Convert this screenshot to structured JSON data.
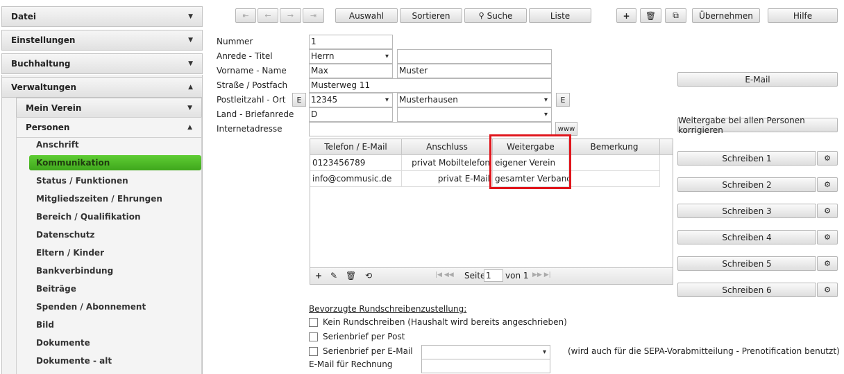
{
  "sidebar": {
    "sections": [
      "Datei",
      "Einstellungen",
      "Buchhaltung",
      "Verwaltungen"
    ],
    "sub_sections": [
      "Mein Verein",
      "Personen"
    ],
    "items": [
      "Anschrift",
      "Kommunikation",
      "Status / Funktionen",
      "Mitgliedszeiten / Ehrungen",
      "Bereich / Qualifikation",
      "Datenschutz",
      "Eltern / Kinder",
      "Bankverbindung",
      "Beiträge",
      "Spenden / Abonnement",
      "Bild",
      "Dokumente",
      "Dokumente - alt"
    ]
  },
  "toolbar": {
    "nav": [
      "⇤",
      "←",
      "→",
      "⇥"
    ],
    "auswahl": "Auswahl",
    "sortieren": "Sortieren",
    "suche": "Suche",
    "liste": "Liste",
    "add": "+",
    "delete": "🗑",
    "copy": "⧉",
    "uebernehmen": "Übernehmen",
    "hilfe": "Hilfe"
  },
  "form": {
    "labels": [
      "Nummer",
      "Anrede - Titel",
      "Vorname - Name",
      "Straße / Postfach",
      "Postleitzahl - Ort",
      "Land - Briefanrede",
      "Internetadresse"
    ],
    "nummer": "1",
    "anrede": "Herrn",
    "titel": "",
    "vorname": "Max",
    "name": "Muster",
    "strasse": "Musterweg 11",
    "plz": "12345",
    "ort": "Musterhausen",
    "land": "D",
    "briefanrede": "",
    "internet": "",
    "e_button": "E",
    "www_button": "www"
  },
  "grid": {
    "headers": [
      "Telefon / E-Mail",
      "Anschluss",
      "Weitergabe",
      "Bemerkung"
    ],
    "rows": [
      {
        "contact": "0123456789",
        "type": "privat Mobiltelefon",
        "share": "eigener Verein",
        "note": ""
      },
      {
        "contact": "info@commusic.de",
        "type": "privat E-Mail",
        "share": "gesamter Verband",
        "note": ""
      }
    ],
    "footer": {
      "page_label": "Seite",
      "page": "1",
      "of_label": "von 1"
    }
  },
  "right": {
    "email": "E-Mail",
    "weitergabe": "Weitergabe bei allen Personen korrigieren",
    "schreiben": [
      "Schreiben 1",
      "Schreiben 2",
      "Schreiben 3",
      "Schreiben 4",
      "Schreiben 5",
      "Schreiben 6"
    ]
  },
  "bottom": {
    "heading": "Bevorzugte Rundschreibenzustellung:",
    "options": [
      "Kein Rundschreiben (Haushalt wird bereits angeschrieben)",
      "Serienbrief per Post",
      "Serienbrief per E-Mail"
    ],
    "sepa_note": "(wird auch für die SEPA-Vorabmitteilung - Prenotification benutzt)",
    "rechnung_label": "E-Mail für Rechnung",
    "rechnung_value": ""
  },
  "colors": {
    "active_nav": "#4cb828",
    "highlight": "#e0151c"
  }
}
